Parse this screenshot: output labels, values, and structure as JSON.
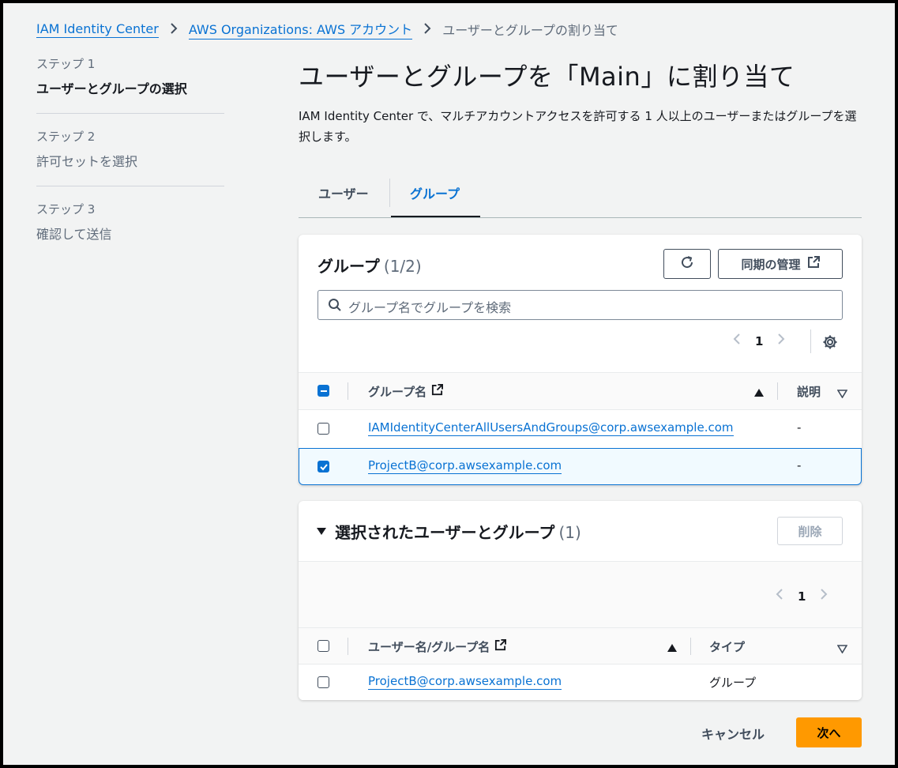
{
  "breadcrumb": {
    "items": [
      "IAM Identity Center",
      "AWS Organizations: AWS アカウント"
    ],
    "current": "ユーザーとグループの割り当て"
  },
  "steps": [
    {
      "caption": "ステップ 1",
      "title": "ユーザーとグループの選択",
      "active": true
    },
    {
      "caption": "ステップ 2",
      "title": "許可セットを選択",
      "active": false
    },
    {
      "caption": "ステップ 3",
      "title": "確認して送信",
      "active": false
    }
  ],
  "main": {
    "title": "ユーザーとグループを「Main」に割り当て",
    "description": "IAM Identity Center で、マルチアカウントアクセスを許可する 1 人以上のユーザーまたはグループを選択します。",
    "tabs": [
      {
        "label": "ユーザー",
        "active": false
      },
      {
        "label": "グループ",
        "active": true
      }
    ]
  },
  "groups_panel": {
    "title": "グループ",
    "count": "(1/2)",
    "manage_sync_label": "同期の管理",
    "search_placeholder": "グループ名でグループを検索",
    "page": "1",
    "columns": [
      "グループ名",
      "説明"
    ],
    "rows": [
      {
        "name": "IAMIdentityCenterAllUsersAndGroups@corp.awsexample.com",
        "description": "-",
        "checked": false
      },
      {
        "name": "ProjectB@corp.awsexample.com",
        "description": "-",
        "checked": true
      }
    ]
  },
  "selected_panel": {
    "title": "選択されたユーザーとグループ",
    "count": "(1)",
    "remove_label": "削除",
    "page": "1",
    "columns": [
      "ユーザー名/グループ名",
      "タイプ"
    ],
    "rows": [
      {
        "name": "ProjectB@corp.awsexample.com",
        "type": "グループ",
        "checked": false
      }
    ]
  },
  "footer": {
    "cancel_label": "キャンセル",
    "next_label": "次へ"
  },
  "colors": {
    "link": "#0972d3",
    "primary_button": "#ff9900",
    "background": "#f2f3f3"
  }
}
